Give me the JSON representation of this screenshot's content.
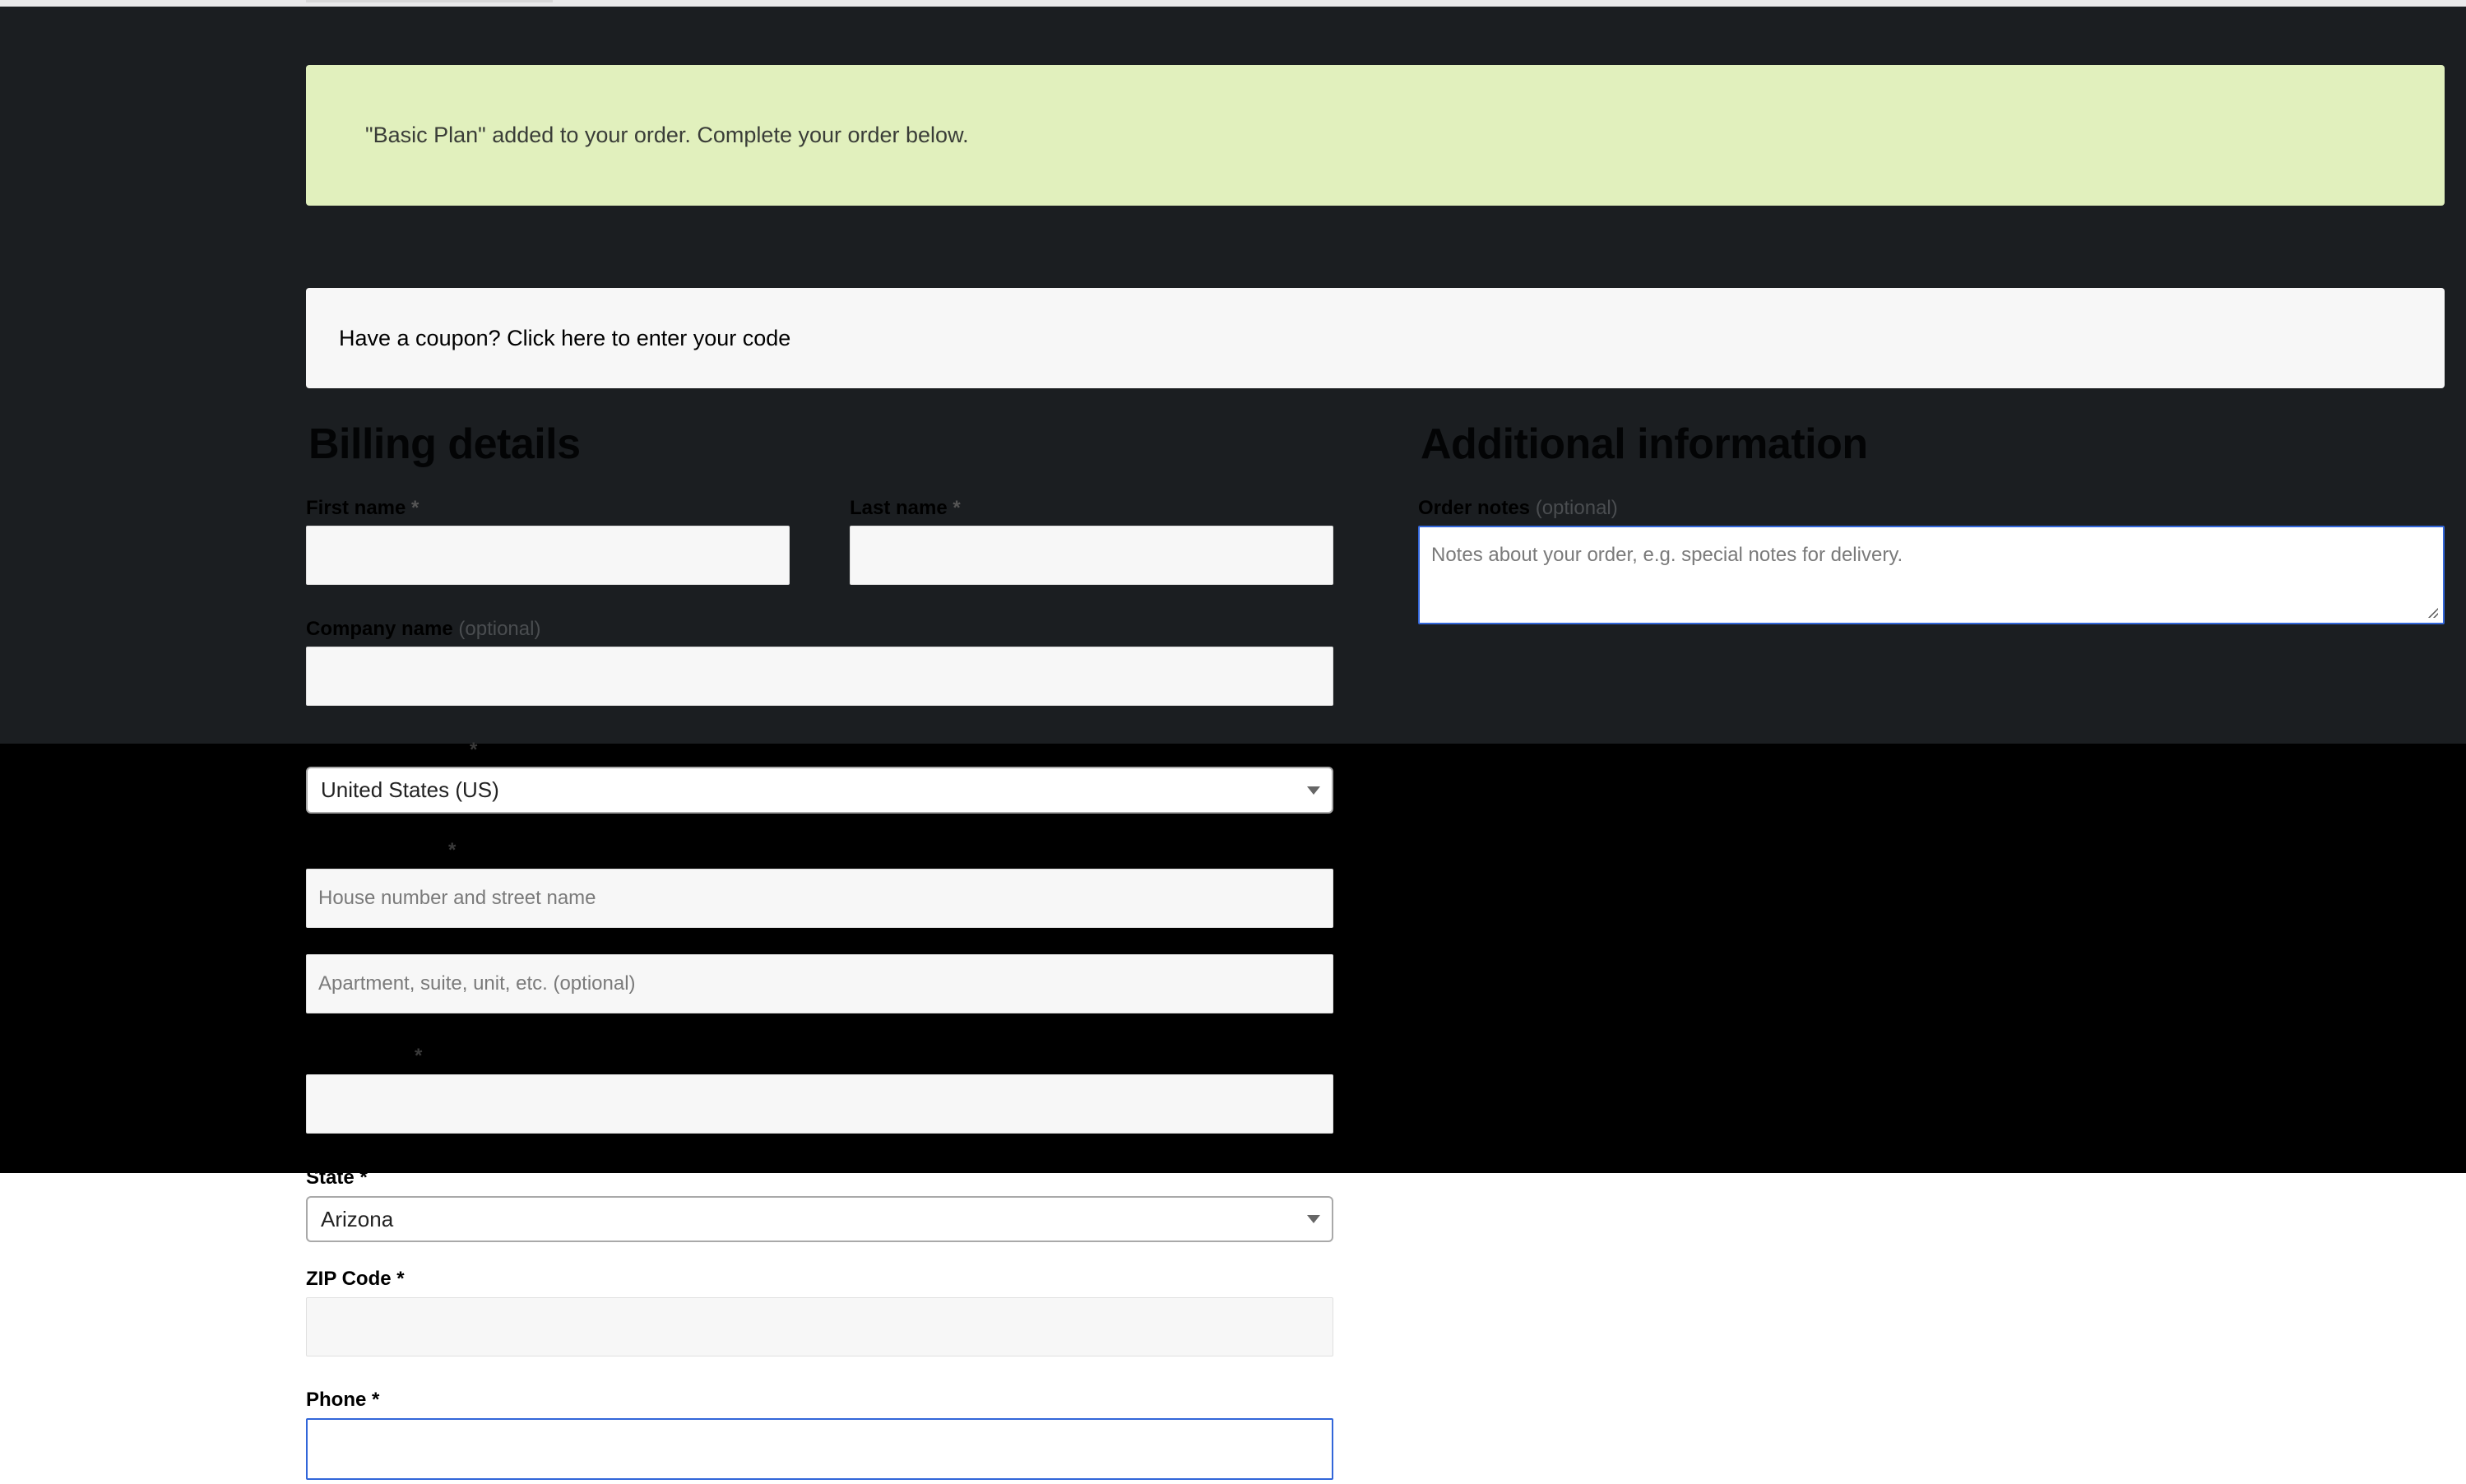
{
  "notice": {
    "text": "\"Basic Plan\" added to your order. Complete your order below."
  },
  "coupon": {
    "text": "Have a coupon? Click here to enter your code"
  },
  "billing": {
    "title": "Billing details",
    "first_name_label": "First name",
    "last_name_label": "Last name",
    "company_label": "Company name",
    "optional": "(optional)",
    "required_mark": "*",
    "country_value": "United States (US)",
    "street_placeholder": "House number and street name",
    "apartment_placeholder": "Apartment, suite, unit, etc. (optional)",
    "state_label": "State",
    "state_value": "Arizona",
    "zip_label": "ZIP Code",
    "phone_label": "Phone"
  },
  "additional": {
    "title": "Additional information",
    "order_notes_label": "Order notes",
    "optional": "(optional)",
    "order_notes_placeholder": "Notes about your order, e.g. special notes for delivery."
  },
  "colors": {
    "notice_bg": "#e1f0bd",
    "dark_band": "#1b1e21",
    "focus_border": "#3266d9"
  }
}
